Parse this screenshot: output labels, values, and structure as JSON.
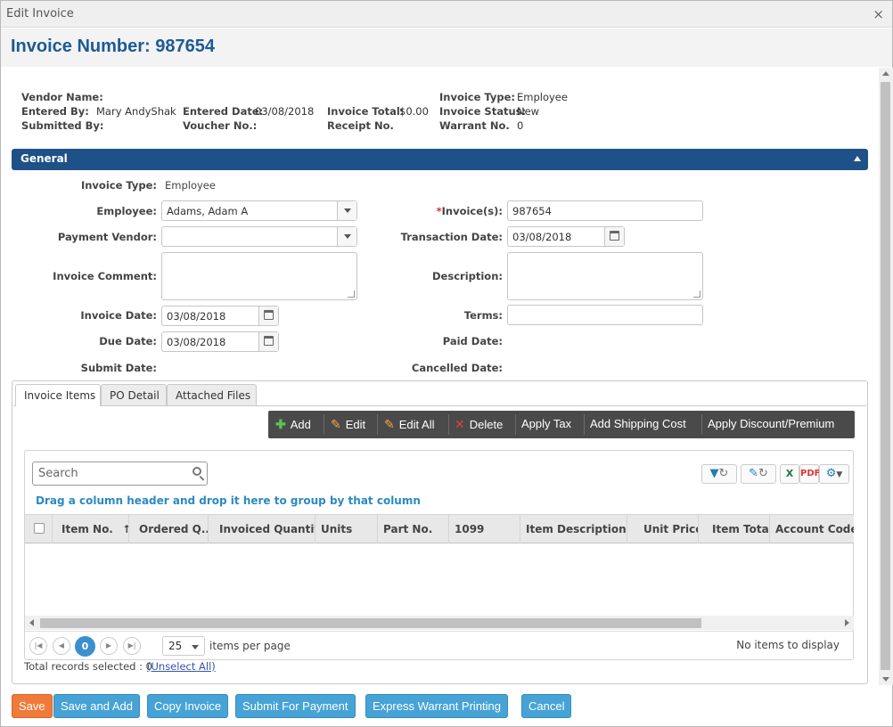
{
  "window": {
    "title": "Edit Invoice",
    "close": "×"
  },
  "header": {
    "invoice_number": "Invoice Number: 987654"
  },
  "summary": {
    "vendor_name_label": "Vendor Name:",
    "vendor_name": "",
    "entered_by_label": "Entered By:",
    "entered_by": "Mary AndyShak",
    "submitted_by_label": "Submitted By:",
    "submitted_by": "",
    "entered_date_label": "Entered Date:",
    "entered_date": "03/08/2018",
    "voucher_no_label": "Voucher No.:",
    "voucher_no": "",
    "invoice_total_label": "Invoice Total:",
    "invoice_total": "$0.00",
    "receipt_no_label": "Receipt No.",
    "receipt_no": "",
    "invoice_type_label": "Invoice Type:",
    "invoice_type": "Employee",
    "invoice_status_label": "Invoice Status:",
    "invoice_status": "New",
    "warrant_no_label": "Warrant No.",
    "warrant_no": "0"
  },
  "section": {
    "title": "General"
  },
  "form": {
    "invoice_type_label": "Invoice Type:",
    "invoice_type": "Employee",
    "employee_label": "Employee:",
    "employee": "Adams, Adam A",
    "payment_vendor_label": "Payment Vendor:",
    "payment_vendor": "",
    "invoice_comment_label": "Invoice Comment:",
    "invoice_date_label": "Invoice Date:",
    "invoice_date": "03/08/2018",
    "due_date_label": "Due Date:",
    "due_date": "03/08/2018",
    "submit_date_label": "Submit Date:",
    "required_mark": "*",
    "invoices_label": "Invoice(s):",
    "invoices": "987654",
    "transaction_date_label": "Transaction Date:",
    "transaction_date": "03/08/2018",
    "description_label": "Description:",
    "terms_label": "Terms:",
    "terms": "",
    "paid_date_label": "Paid Date:",
    "cancelled_date_label": "Cancelled Date:"
  },
  "tabs": [
    "Invoice Items",
    "PO Detail",
    "Attached Files"
  ],
  "toolbar": {
    "add": "Add",
    "edit": "Edit",
    "edit_all": "Edit All",
    "delete": "Delete",
    "apply_tax": "Apply Tax",
    "add_shipping": "Add Shipping Cost",
    "apply_discount": "Apply Discount/Premium"
  },
  "grid": {
    "search_placeholder": "Search",
    "group_hint": "Drag a column header and drop it here to group by that column",
    "columns": [
      "Item No.",
      "Ordered Q...",
      "Invoiced Quantity",
      "Units",
      "Part No.",
      "1099",
      "Item Description",
      "Unit Price",
      "Item Total",
      "Account Code"
    ],
    "sort_indicator": "↑",
    "current_page": "0",
    "page_size": "25",
    "items_per_page": "items per page",
    "no_items": "No items to display",
    "total_selected": "Total records selected : 0",
    "unselect_all": "(Unselect All)"
  },
  "buttons": {
    "save": "Save",
    "save_and_add": "Save and Add",
    "copy_invoice": "Copy Invoice",
    "submit_for_payment": "Submit For Payment",
    "express_warrant": "Express Warrant Printing",
    "cancel": "Cancel"
  },
  "colors": {
    "title_blue": "#1e5a96",
    "section_bar": "#1e5187",
    "button_blue": "#47a3d6",
    "button_orange": "#f07a3a",
    "toolbar": "#4a4a4a"
  }
}
